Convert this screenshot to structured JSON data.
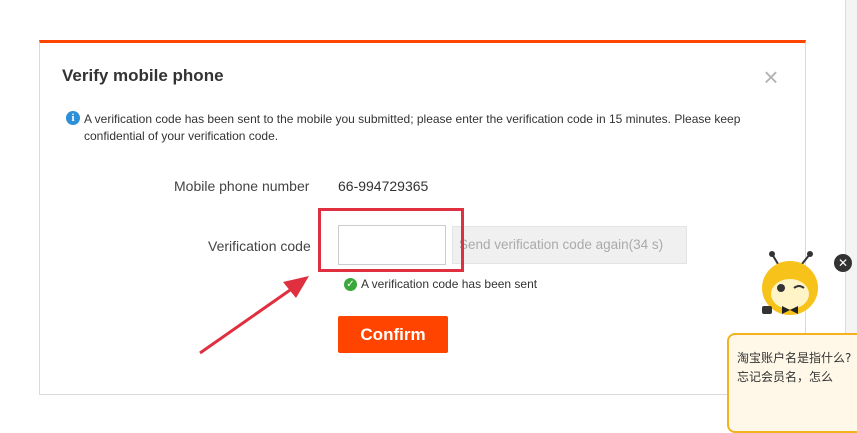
{
  "dialog": {
    "title": "Verify mobile phone",
    "close_glyph": "×",
    "info_glyph": "i",
    "notice": "A verification code has been sent to the mobile you submitted; please enter the verification code in 15 minutes. Please keep confidential of your verification code.",
    "phone_label": "Mobile phone number",
    "phone_value": "66-994729365",
    "code_label": "Verification code",
    "code_value": "",
    "code_placeholder": "",
    "resend_label": "Send verification code again(34 s)",
    "sent_glyph": "✓",
    "sent_message": "A verification code has been sent",
    "confirm_label": "Confirm"
  },
  "assistant": {
    "close_glyph": "✕",
    "bubble_line1": "淘宝账户名是指什么?",
    "bubble_line2": "忘记会员名，怎么"
  },
  "colors": {
    "accent": "#ff4400",
    "highlight": "#e03040",
    "info": "#2d8fd5",
    "success": "#3aa83a",
    "mascot_yellow": "#f7c21a"
  },
  "icons": {
    "close": "close-icon",
    "info": "info-icon",
    "success": "check-circle-icon",
    "arrow": "red-arrow-annotation",
    "mascot": "bee-mascot-icon"
  }
}
